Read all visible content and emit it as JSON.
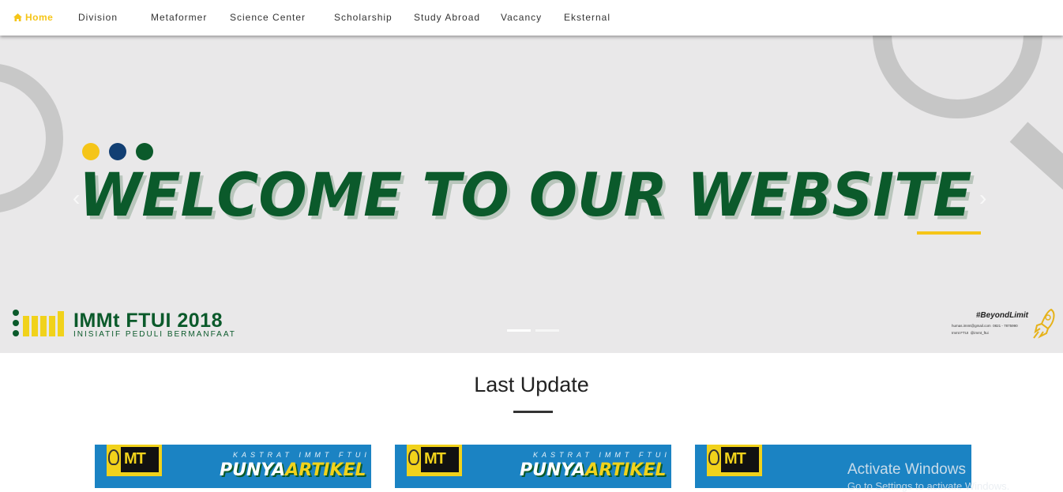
{
  "nav": {
    "items": [
      {
        "label": "Home",
        "active": true
      },
      {
        "label": "Division"
      },
      {
        "label": "Metaformer"
      },
      {
        "label": "Science Center"
      },
      {
        "label": "Scholarship"
      },
      {
        "label": "Study Abroad"
      },
      {
        "label": "Vacancy"
      },
      {
        "label": "Eksternal"
      }
    ]
  },
  "hero": {
    "headline": "WELCOME TO OUR WEBSITE",
    "dot_colors": [
      "#f5c518",
      "#123f73",
      "#0b5a2b"
    ],
    "logo_title": "IMMt FTUI 2018",
    "logo_subtitle": "INISIATIF PEDULI BERMANFAAT",
    "hashtag": "#BeyondLimit",
    "contacts": [
      "humas.immt@gmail.com",
      "0821 - 7875990",
      "Immt FTUI",
      "@immt_ftui"
    ],
    "prev_icon": "chevron-left-icon",
    "next_icon": "chevron-right-icon",
    "slide_count": 2,
    "active_slide": 1
  },
  "last_update": {
    "title": "Last Update",
    "cards": [
      {
        "kicker": "KASTRAT IMMT FTUI",
        "headline_1": "PUNYA",
        "headline_2": "ARTIKEL",
        "logo": "MT"
      },
      {
        "kicker": "KASTRAT IMMT FTUI",
        "headline_1": "PUNYA",
        "headline_2": "ARTIKEL",
        "logo": "MT"
      },
      {
        "logo": "MT"
      }
    ]
  },
  "watermark": {
    "title": "Activate Windows",
    "subtitle": "Go to Settings to activate Windows."
  },
  "colors": {
    "brand_green": "#0b5a2b",
    "brand_yellow": "#f5c518",
    "card_blue": "#1b83c3",
    "hero_bg": "#e9e8e9"
  }
}
